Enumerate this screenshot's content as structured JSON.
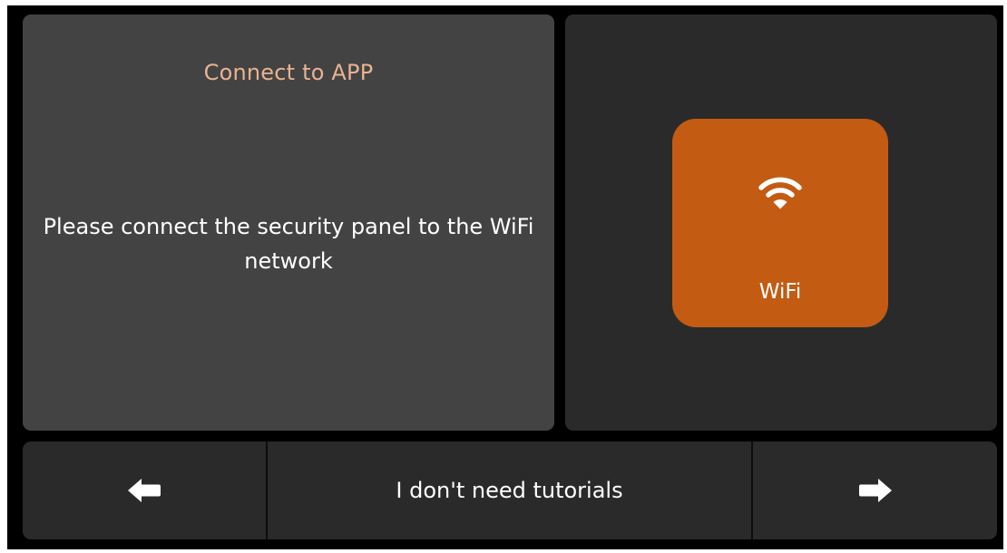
{
  "info_panel": {
    "title": "Connect to APP",
    "message": "Please connect the security panel to the WiFi network"
  },
  "connection_option": {
    "label": "WiFi",
    "icon": "wifi-icon",
    "tile_color": "#c35b13"
  },
  "bottom_bar": {
    "back_icon": "arrow-left-icon",
    "skip_label": "I don't need tutorials",
    "next_icon": "arrow-right-icon"
  },
  "colors": {
    "screen_background": "#000000",
    "info_panel_background": "#434343",
    "secondary_panel_background": "#2a2a2a",
    "title_text": "#e8b392",
    "accent": "#c35b13",
    "text": "#ffffff"
  }
}
